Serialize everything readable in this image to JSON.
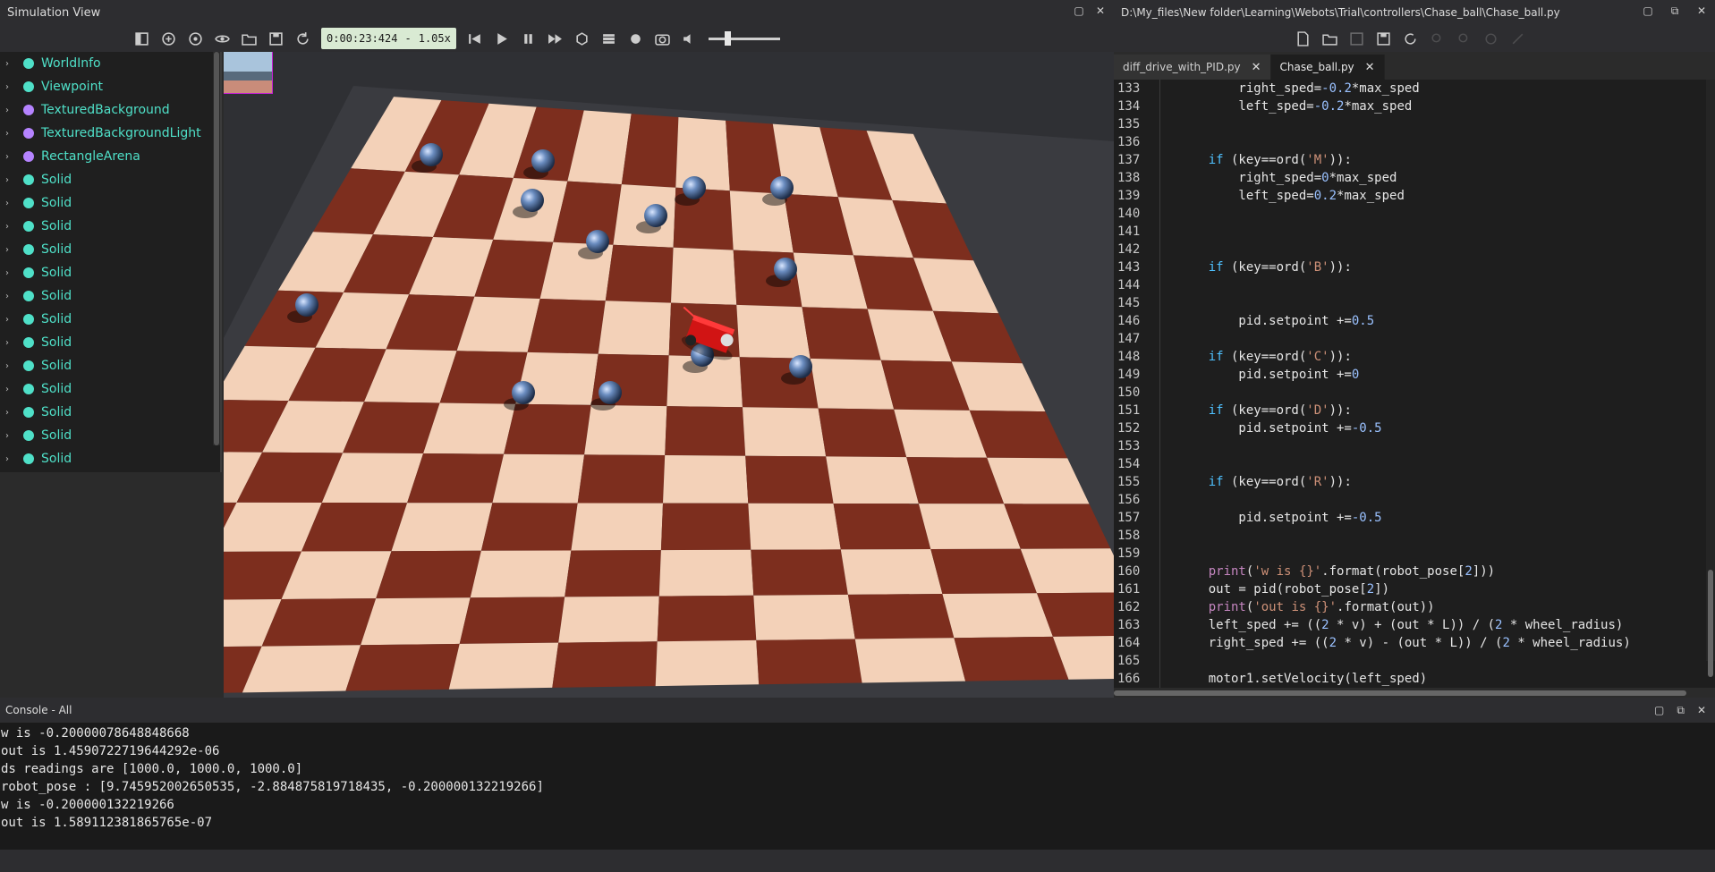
{
  "sim_window": {
    "title": "Simulation View"
  },
  "editor_window": {
    "title": "D:\\My_files\\New folder\\Learning\\Webots\\Trial\\controllers\\Chase_ball\\Chase_ball.py"
  },
  "toolbar": {
    "time": "0:00:23:424",
    "speed": "1.05x",
    "speed_sep": "-",
    "volume_level": 0.25
  },
  "scene_tree": {
    "items": [
      {
        "label": "WorldInfo",
        "color": "#4fe0c8"
      },
      {
        "label": "Viewpoint",
        "color": "#4fe0c8"
      },
      {
        "label": "TexturedBackground",
        "color": "#b583ff"
      },
      {
        "label": "TexturedBackgroundLight",
        "color": "#b583ff"
      },
      {
        "label": "RectangleArena",
        "color": "#b583ff"
      },
      {
        "label": "Solid",
        "color": "#4fe0c8"
      },
      {
        "label": "Solid",
        "color": "#4fe0c8"
      },
      {
        "label": "Solid",
        "color": "#4fe0c8"
      },
      {
        "label": "Solid",
        "color": "#4fe0c8"
      },
      {
        "label": "Solid",
        "color": "#4fe0c8"
      },
      {
        "label": "Solid",
        "color": "#4fe0c8"
      },
      {
        "label": "Solid",
        "color": "#4fe0c8"
      },
      {
        "label": "Solid",
        "color": "#4fe0c8"
      },
      {
        "label": "Solid",
        "color": "#4fe0c8"
      },
      {
        "label": "Solid",
        "color": "#4fe0c8"
      },
      {
        "label": "Solid",
        "color": "#4fe0c8"
      },
      {
        "label": "Solid",
        "color": "#4fe0c8"
      },
      {
        "label": "Solid",
        "color": "#4fe0c8"
      }
    ]
  },
  "editor": {
    "tabs": [
      {
        "label": "diff_drive_with_PID.py",
        "active": false
      },
      {
        "label": "Chase_ball.py",
        "active": true
      }
    ],
    "lines": [
      {
        "n": "133",
        "t": "        right_sped=-0.2*max_sped"
      },
      {
        "n": "134",
        "t": "        left_sped=-0.2*max_sped"
      },
      {
        "n": "135",
        "t": ""
      },
      {
        "n": "136",
        "t": ""
      },
      {
        "n": "137",
        "t": "    if (key==ord('M')):"
      },
      {
        "n": "138",
        "t": "        right_sped=0*max_sped"
      },
      {
        "n": "139",
        "t": "        left_sped=0.2*max_sped"
      },
      {
        "n": "140",
        "t": ""
      },
      {
        "n": "141",
        "t": ""
      },
      {
        "n": "142",
        "t": ""
      },
      {
        "n": "143",
        "t": "    if (key==ord('B')):"
      },
      {
        "n": "144",
        "t": ""
      },
      {
        "n": "145",
        "t": ""
      },
      {
        "n": "146",
        "t": "        pid.setpoint +=0.5"
      },
      {
        "n": "147",
        "t": ""
      },
      {
        "n": "148",
        "t": "    if (key==ord('C')):"
      },
      {
        "n": "149",
        "t": "        pid.setpoint +=0"
      },
      {
        "n": "150",
        "t": ""
      },
      {
        "n": "151",
        "t": "    if (key==ord('D')):"
      },
      {
        "n": "152",
        "t": "        pid.setpoint +=-0.5"
      },
      {
        "n": "153",
        "t": ""
      },
      {
        "n": "154",
        "t": ""
      },
      {
        "n": "155",
        "t": "    if (key==ord('R')):"
      },
      {
        "n": "156",
        "t": ""
      },
      {
        "n": "157",
        "t": "        pid.setpoint +=-0.5"
      },
      {
        "n": "158",
        "t": ""
      },
      {
        "n": "159",
        "t": ""
      },
      {
        "n": "160",
        "t": "    print('w is {}'.format(robot_pose[2]))"
      },
      {
        "n": "161",
        "t": "    out = pid(robot_pose[2])"
      },
      {
        "n": "162",
        "t": "    print('out is {}'.format(out))"
      },
      {
        "n": "163",
        "t": "    left_sped += ((2 * v) + (out * L)) / (2 * wheel_radius)"
      },
      {
        "n": "164",
        "t": "    right_sped += ((2 * v) - (out * L)) / (2 * wheel_radius)"
      },
      {
        "n": "165",
        "t": ""
      },
      {
        "n": "166",
        "t": "    motor1.setVelocity(left_sped)"
      }
    ]
  },
  "console": {
    "title": "Console - All",
    "lines": [
      "w is -0.20000078648848668",
      "out is 1.4590722719644292e-06",
      "ds readings are [1000.0, 1000.0, 1000.0]",
      "robot_pose : [9.745952002650535, -2.884875819718435, -0.200000132219266]",
      "w is -0.200000132219266",
      "out is 1.589112381865765e-07"
    ]
  },
  "colors": {
    "board_dark": "#7d2e1e",
    "board_light": "#f3d1b8",
    "robot": "#d11414",
    "ball": "#3d5a84"
  }
}
